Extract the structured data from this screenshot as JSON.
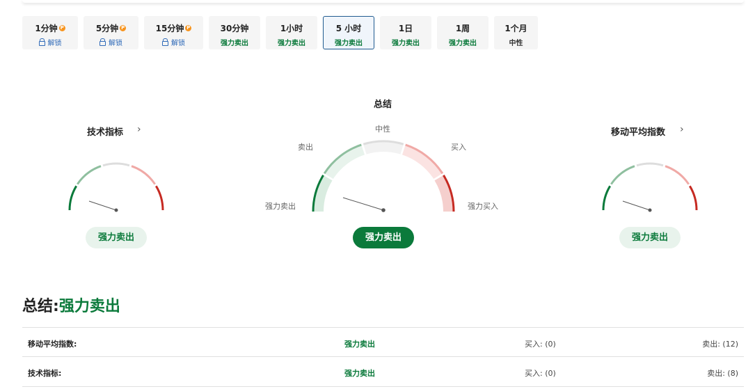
{
  "timeframes": [
    {
      "label": "1分钟",
      "sub": "解锁",
      "locked": true
    },
    {
      "label": "5分钟",
      "sub": "解锁",
      "locked": true
    },
    {
      "label": "15分钟",
      "sub": "解锁",
      "locked": true
    },
    {
      "label": "30分钟",
      "sub": "强力卖出",
      "locked": false
    },
    {
      "label": "1小时",
      "sub": "强力卖出",
      "locked": false
    },
    {
      "label": "5 小时",
      "sub": "强力卖出",
      "locked": false,
      "active": true
    },
    {
      "label": "1日",
      "sub": "强力卖出",
      "locked": false
    },
    {
      "label": "1周",
      "sub": "强力卖出",
      "locked": false
    },
    {
      "label": "1个月",
      "sub": "中性",
      "locked": false
    }
  ],
  "pro_badge": "P",
  "gauges": {
    "technical": {
      "title": "技术指标",
      "result": "强力卖出"
    },
    "summary": {
      "title": "总结",
      "result": "强力卖出",
      "labels": {
        "strong_sell": "强力卖出",
        "sell": "卖出",
        "neutral": "中性",
        "buy": "买入",
        "strong_buy": "强力买入"
      }
    },
    "moving_avg": {
      "title": "移动平均指数",
      "result": "强力卖出"
    }
  },
  "summary": {
    "label": "总结:",
    "value": "强力卖出"
  },
  "table": [
    {
      "name": "移动平均指数:",
      "signal": "强力卖出",
      "buy": "买入: (0)",
      "sell": "卖出: (12)"
    },
    {
      "name": "技术指标:",
      "signal": "强力卖出",
      "buy": "买入: (0)",
      "sell": "卖出: (8)"
    }
  ],
  "colors": {
    "strong_sell": "#0b7a3b",
    "sell": "#8fbf9f",
    "neutral": "#dddddd",
    "buy": "#f0a9a6",
    "strong_buy": "#c62a22",
    "active_border": "#1f5a8f",
    "pro": "#f7941d"
  },
  "icons": {
    "chevron": "chevron-right-icon",
    "lock": "lock-icon",
    "pro": "pro-badge-icon"
  }
}
